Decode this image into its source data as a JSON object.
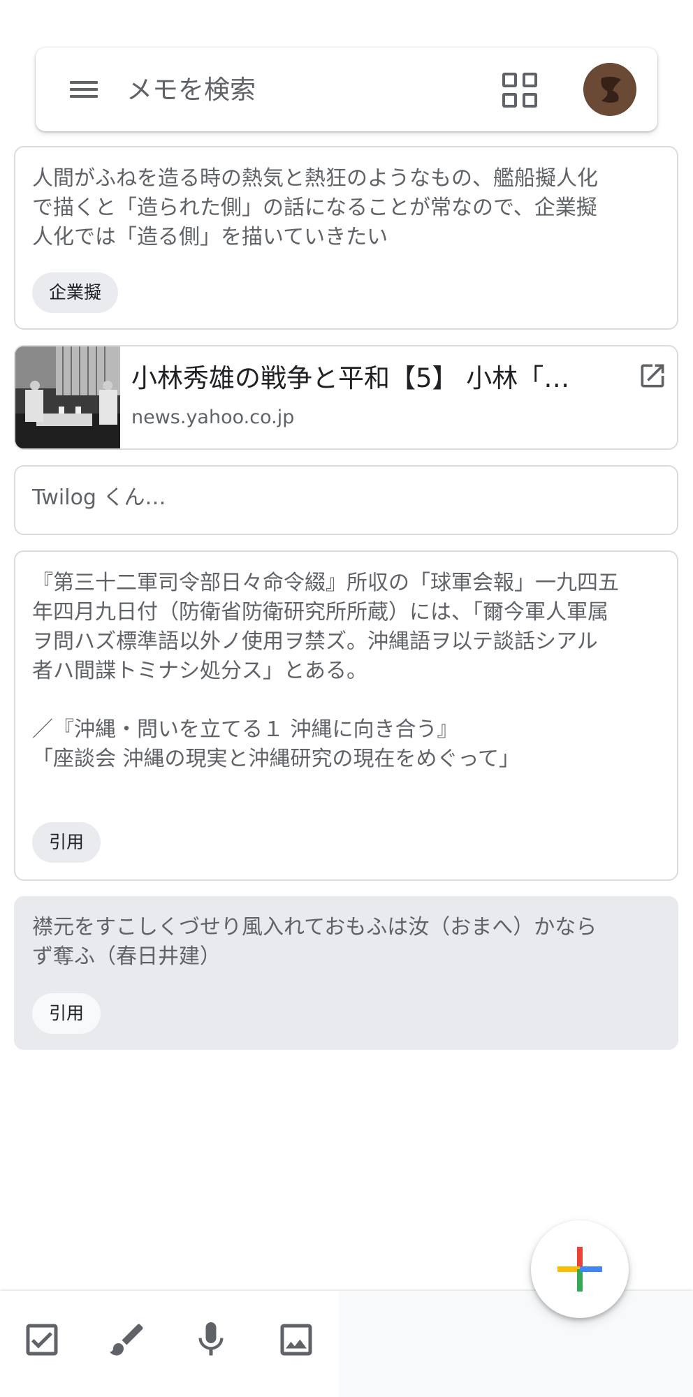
{
  "search": {
    "placeholder": "メモを検索"
  },
  "notes": [
    {
      "text": "人間がふねを造る時の熱気と熱狂のようなもの、艦船擬人化\nで描くと「造られた側」の話になることが常なので、企業擬\n人化では「造る側」を描いていきたい",
      "label": "企業擬"
    },
    {
      "link_title": "小林秀雄の戦争と平和【5】 小林「…",
      "link_domain": "news.yahoo.co.jp"
    },
    {
      "text": "Twilog くん…"
    },
    {
      "text": "『第三十二軍司令部日々命令綴』所収の「球軍会報」一九四五\n年四月九日付（防衛省防衛研究所所蔵）には、「爾今軍人軍属\nヲ問ハズ標準語以外ノ使用ヲ禁ズ。沖縄語ヲ以テ談話シアル\n者ハ間諜トミナシ処分ス」とある。\n\n／『沖縄・問いを立てる１ 沖縄に向き合う』\n「座談会 沖縄の現実と沖縄研究の現在をめぐって」",
      "label": "引用"
    },
    {
      "text": "襟元をすこしくづせり風入れておもふは汝（おまへ）かなら\nず奪ふ（春日井建）",
      "label": "引用"
    }
  ],
  "icons": {
    "menu": "menu-icon",
    "layout": "grid-view-icon",
    "account": "avatar",
    "open_link": "open-in-new-icon",
    "checkbox": "checkbox-icon",
    "drawing": "brush-icon",
    "audio": "microphone-icon",
    "image": "image-icon",
    "new_note": "plus-icon"
  },
  "colors": {
    "fab_plus": [
      "#EA4335",
      "#FBBC04",
      "#34A853",
      "#4285F4"
    ],
    "highlighted_note": "#e8eaed"
  }
}
